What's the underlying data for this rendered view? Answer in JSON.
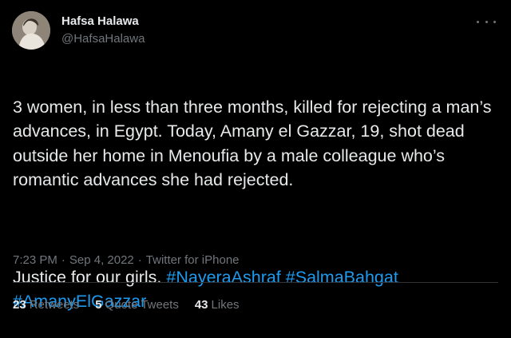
{
  "author": {
    "display_name": "Hafsa Halawa",
    "handle": "@HafsaHalawa"
  },
  "tweet": {
    "line1": "3 women, in less than three months, killed for rejecting a man’s advances, in Egypt. Today, Amany el Gazzar, 19, shot dead outside her home in Menoufia by a male colleague who’s romantic advances she had rejected.",
    "justice_text": "Justice for our girls. ",
    "hashtags": [
      "#NayeraAshraf",
      "#SalmaBahgat",
      "#AmanyElGazzar"
    ]
  },
  "meta": {
    "time": "7:23 PM",
    "separator": "·",
    "date": "Sep 4, 2022",
    "source": "Twitter for iPhone"
  },
  "stats": {
    "retweets_count": "23",
    "retweets_label": "Retweets",
    "quotes_count": "5",
    "quotes_label": "Quote Tweets",
    "likes_count": "43",
    "likes_label": "Likes"
  },
  "icons": {
    "more": "more-horizontal-icon"
  },
  "colors": {
    "background": "#000000",
    "text": "#e7e9ea",
    "secondary": "#71767b",
    "link": "#1d9bf0",
    "divider": "#2f3336"
  }
}
